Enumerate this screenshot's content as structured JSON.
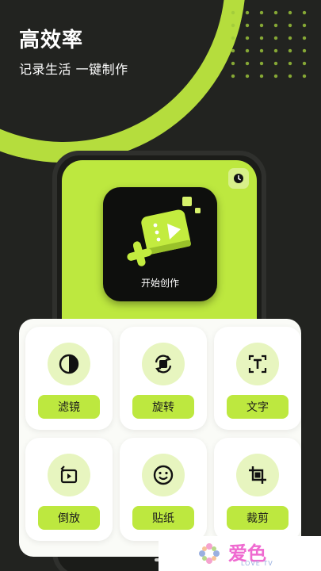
{
  "header": {
    "title": "高效率",
    "subtitle": "记录生活 一键制作"
  },
  "phone": {
    "create_label": "开始创作",
    "timer_icon": "timer-icon"
  },
  "tools": [
    {
      "label": "滤镜",
      "icon": "filter-icon"
    },
    {
      "label": "旋转",
      "icon": "rotate-icon"
    },
    {
      "label": "文字",
      "icon": "text-icon"
    },
    {
      "label": "倒放",
      "icon": "reverse-play-icon"
    },
    {
      "label": "贴纸",
      "icon": "sticker-icon"
    },
    {
      "label": "裁剪",
      "icon": "crop-icon"
    }
  ],
  "watermark": {
    "text": "爱色",
    "sub": "LOVE TV"
  },
  "colors": {
    "accent": "#bde83f",
    "background": "#222320",
    "panel": "#fafbf7",
    "circle": "#e7f5bf"
  }
}
